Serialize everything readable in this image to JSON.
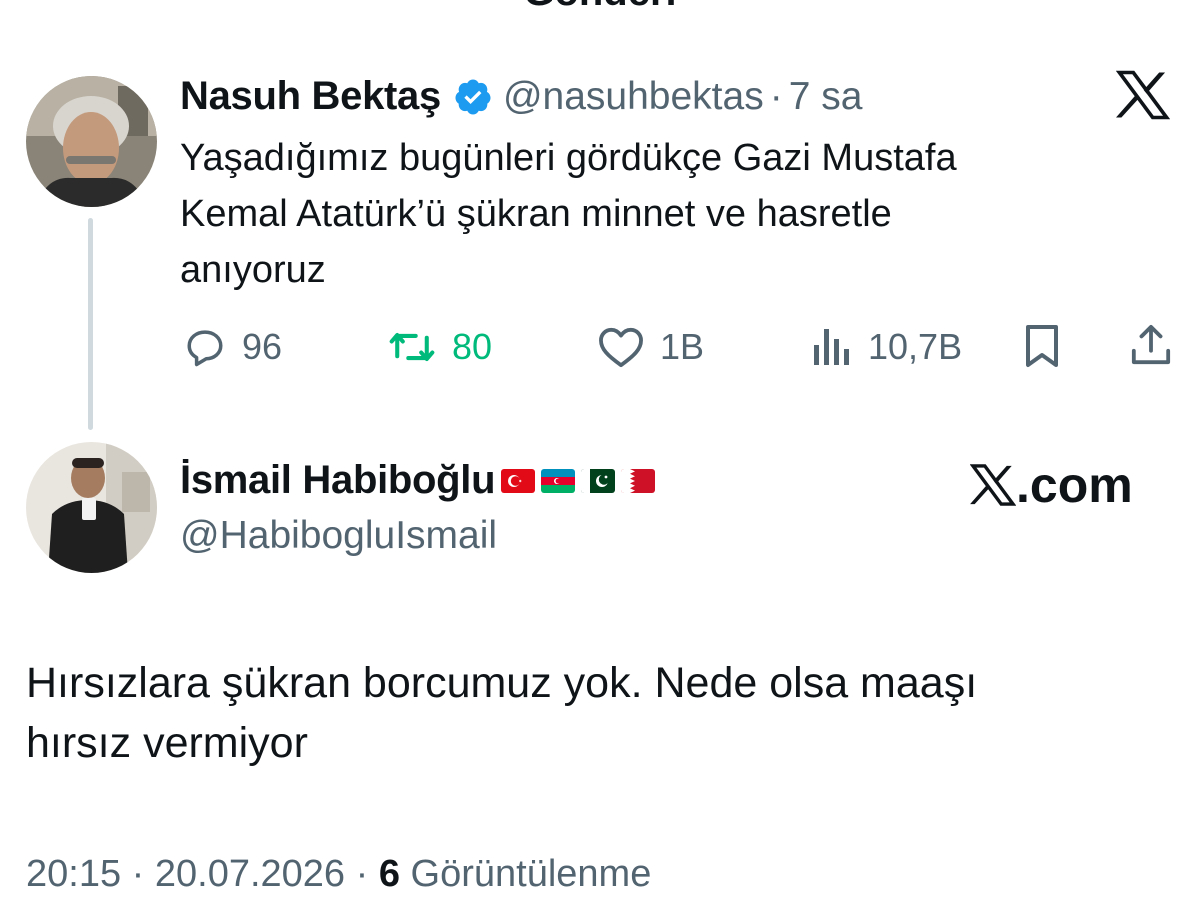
{
  "header": {
    "title": "Gönderi"
  },
  "original_tweet": {
    "author_name": "Nasuh Bektaş",
    "handle": "@nasuhbektas",
    "separator": "·",
    "time": "7 sa",
    "text_lines": [
      "Yaşadığımız bugünleri gördükçe Gazi Mustafa",
      "Kemal Atatürk’ü şükran minnet ve hasretle",
      "anıyoruz"
    ],
    "metrics": {
      "replies": "96",
      "retweets": "80",
      "likes": "1B",
      "views": "10,7B"
    }
  },
  "reply": {
    "author_name": "İsmail Habiboğlu",
    "flags": [
      "Turkey",
      "Azerbaijan",
      "Pakistan",
      "Bahrain"
    ],
    "handle": "@HabibogluIsmail",
    "watermark": ".com",
    "text_lines": [
      "Hırsızlara şükran borcumuz yok. Nede olsa maaşı",
      "hırsız vermiyor"
    ]
  },
  "footer": {
    "time": "20:15",
    "date": "20.07.2026",
    "separator": "·",
    "views_count": "6",
    "views_label": "Görüntülenme"
  },
  "colors": {
    "text": "#0f1419",
    "secondary": "#536471",
    "verified": "#1d9bf0",
    "retweet": "#00ba7c"
  }
}
